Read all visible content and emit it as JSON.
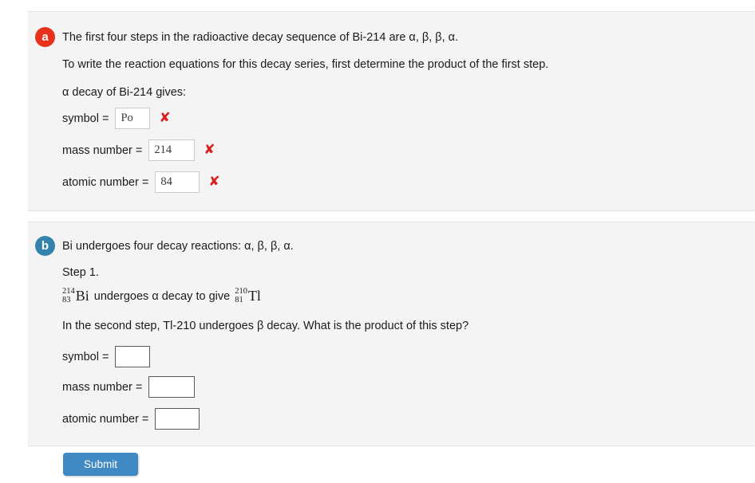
{
  "part_a": {
    "badge": "a",
    "statement": "The first four steps in the radioactive decay sequence of Bi-214 are α, β, β, α.",
    "instruction": "To write the reaction equations for this decay series, first determine the product of the first step.",
    "prompt": "α decay of Bi-214 gives:",
    "fields": [
      {
        "label": "symbol =",
        "value": "Po",
        "status_icon": "✘",
        "status": "incorrect"
      },
      {
        "label": "mass number =",
        "value": "214",
        "status_icon": "✘",
        "status": "incorrect"
      },
      {
        "label": "atomic number =",
        "value": "84",
        "status_icon": "✘",
        "status": "incorrect"
      }
    ]
  },
  "part_b": {
    "badge": "b",
    "statement": "Bi undergoes four decay reactions: α, β, β, α.",
    "step_label": "Step 1.",
    "equation": {
      "reactant": {
        "mass_number": "214",
        "atomic_number": "83",
        "symbol": "Bi"
      },
      "verb": "undergoes α decay to give",
      "product": {
        "mass_number": "210",
        "atomic_number": "81",
        "symbol": "Tl"
      }
    },
    "question": "In the second step, Tl-210 undergoes β decay. What is the product of this step?",
    "fields": [
      {
        "label": "symbol =",
        "value": "",
        "placeholder": ""
      },
      {
        "label": "mass number =",
        "value": "",
        "placeholder": ""
      },
      {
        "label": "atomic number =",
        "value": "",
        "placeholder": ""
      }
    ]
  },
  "footer": {
    "submit_label": "Submit"
  },
  "colors": {
    "badge_a": "#e8311b",
    "badge_b": "#3483ad",
    "submit": "#4189c3",
    "incorrect": "#d81f20",
    "panel": "#f4f4f4"
  }
}
